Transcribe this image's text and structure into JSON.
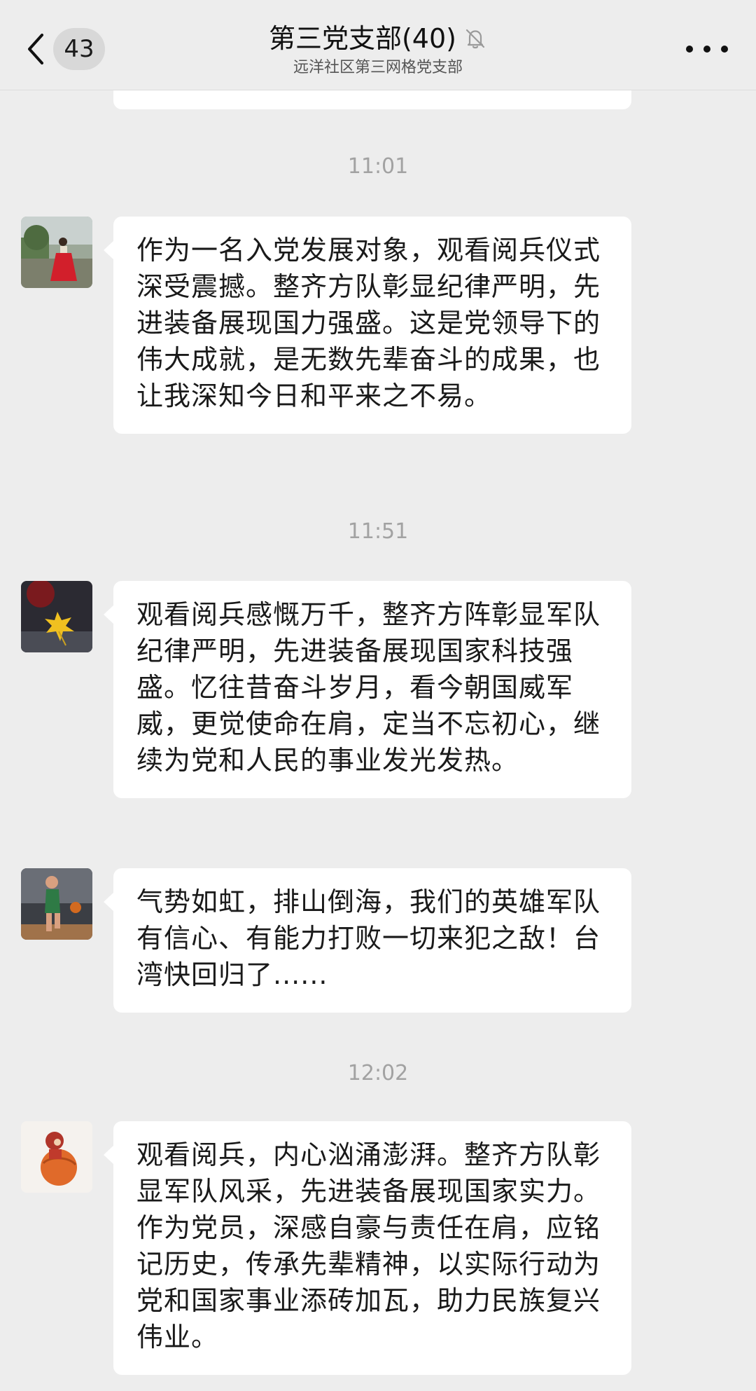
{
  "header": {
    "unread_count": "43",
    "title": "第三党支部(40)",
    "subtitle": "远洋社区第三网格党支部"
  },
  "timestamps": [
    "11:01",
    "11:51",
    "12:02"
  ],
  "messages": [
    {
      "text": "作为一名入党发展对象，观看阅兵仪式深受震撼。整齐方队彰显纪律严明，先进装备展现国力强盛。这是党领导下的伟大成就，是无数先辈奋斗的成果，也让我深知今日和平来之不易。"
    },
    {
      "text": "观看阅兵感慨万千，整齐方阵彰显军队纪律严明，先进装备展现国家科技强盛。忆往昔奋斗岁月，看今朝国威军威，更觉使命在肩，定当不忘初心，继续为党和人民的事业发光发热。"
    },
    {
      "text": "气势如虹，排山倒海，我们的英雄军队有信心、有能力打败一切来犯之敌！台湾快回归了......"
    },
    {
      "text": "观看阅兵，内心汹涌澎湃。整齐方队彰显军队风采，先进装备展现国家实力。作为党员，深感自豪与责任在肩，应铭记历史，传承先辈精神，以实际行动为党和国家事业添砖加瓦，助力民族复兴伟业。"
    }
  ]
}
